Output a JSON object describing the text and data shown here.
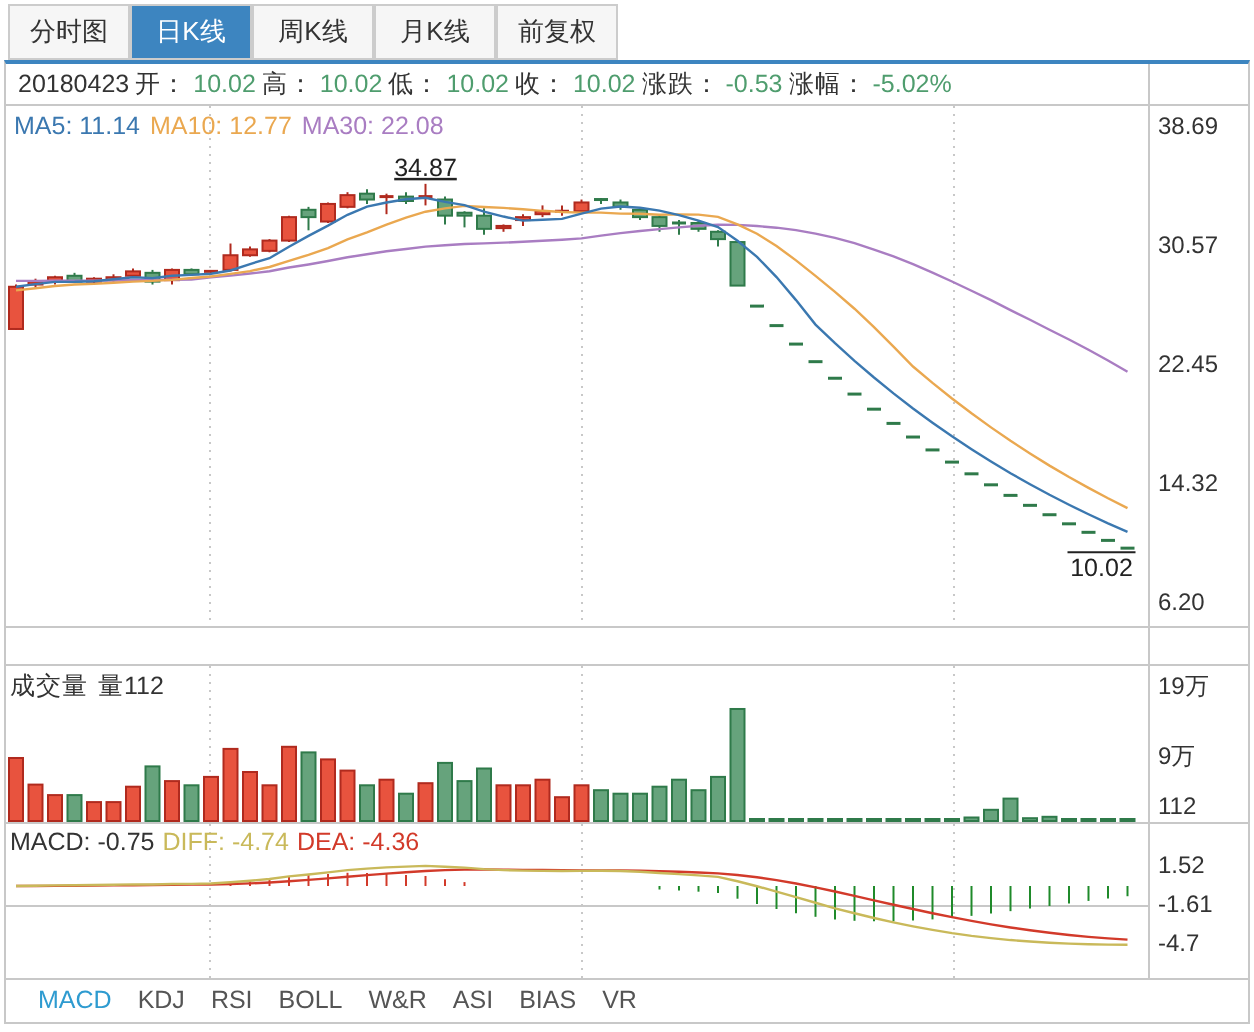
{
  "tabs": [
    {
      "label": "分时图",
      "selected": false
    },
    {
      "label": "日K线",
      "selected": true
    },
    {
      "label": "周K线",
      "selected": false
    },
    {
      "label": "月K线",
      "selected": false
    },
    {
      "label": "前复权",
      "selected": false
    }
  ],
  "quote": {
    "date": "20180423",
    "fields": [
      {
        "label": "开：",
        "value": "10.02"
      },
      {
        "label": "高：",
        "value": "10.02"
      },
      {
        "label": "低：",
        "value": "10.02"
      },
      {
        "label": "收：",
        "value": "10.02"
      },
      {
        "label": "涨跌：",
        "value": "-0.53"
      },
      {
        "label": "涨幅：",
        "value": "-5.02%"
      }
    ]
  },
  "price_chart": {
    "legend": [
      {
        "text": "MA5: 11.14",
        "color": "#3b78b0"
      },
      {
        "text": "MA10: 12.77",
        "color": "#eaa850"
      },
      {
        "text": "MA30: 22.08",
        "color": "#a97dc2"
      }
    ],
    "high_label": "34.87",
    "low_label": "10.02",
    "chart_data": {
      "type": "candlestick",
      "ylim": [
        4.71,
        40.18
      ],
      "grid": true,
      "categories": [
        null,
        null,
        null,
        null,
        null,
        null,
        null,
        null,
        null,
        null,
        null,
        null,
        null,
        null,
        null,
        null,
        null,
        null,
        null,
        null,
        null,
        null,
        null,
        null,
        null,
        null,
        null,
        null,
        null,
        null,
        null,
        null,
        null,
        null,
        null,
        null,
        null,
        null,
        null,
        null,
        null,
        null,
        null,
        null,
        null,
        null,
        null,
        null,
        null,
        null,
        null,
        null,
        null,
        null,
        null,
        null,
        null,
        null
      ],
      "ohlc": [
        [
          24.97,
          28.0,
          24.9,
          27.85
        ],
        [
          28.0,
          28.4,
          27.8,
          28.2
        ],
        [
          28.2,
          28.6,
          28.0,
          28.5
        ],
        [
          28.6,
          28.8,
          28.1,
          28.2
        ],
        [
          28.2,
          28.5,
          28.0,
          28.4
        ],
        [
          28.3,
          28.7,
          28.2,
          28.5
        ],
        [
          28.6,
          29.1,
          28.5,
          28.9
        ],
        [
          28.8,
          29.0,
          28.0,
          28.2
        ],
        [
          28.3,
          29.1,
          28.0,
          29.0
        ],
        [
          29.0,
          29.1,
          28.6,
          28.7
        ],
        [
          28.8,
          29.0,
          28.7,
          28.9
        ],
        [
          29.0,
          30.8,
          28.9,
          30.0
        ],
        [
          30.0,
          30.6,
          29.9,
          30.4
        ],
        [
          30.3,
          31.1,
          30.2,
          31.0
        ],
        [
          31.0,
          32.7,
          30.9,
          32.6
        ],
        [
          33.1,
          33.3,
          31.7,
          32.6
        ],
        [
          32.3,
          33.6,
          32.2,
          33.5
        ],
        [
          33.3,
          34.3,
          33.2,
          34.1
        ],
        [
          34.2,
          34.5,
          33.5,
          33.8
        ],
        [
          33.9,
          34.2,
          32.8,
          34.0
        ],
        [
          34.0,
          34.3,
          33.5,
          33.7
        ],
        [
          33.9,
          34.87,
          33.4,
          34.0
        ],
        [
          33.8,
          34.0,
          32.1,
          32.7
        ],
        [
          32.9,
          33.0,
          31.9,
          32.7
        ],
        [
          32.7,
          33.2,
          31.4,
          31.8
        ],
        [
          31.85,
          32.1,
          31.6,
          32.0
        ],
        [
          32.4,
          32.8,
          32.0,
          32.6
        ],
        [
          32.8,
          33.4,
          32.6,
          33.0
        ],
        [
          32.9,
          33.4,
          32.7,
          33.0
        ],
        [
          33.0,
          33.8,
          32.9,
          33.6
        ],
        [
          33.8,
          33.9,
          33.5,
          33.7
        ],
        [
          33.6,
          33.8,
          33.1,
          33.3
        ],
        [
          33.1,
          33.2,
          32.4,
          32.6
        ],
        [
          32.6,
          32.7,
          31.6,
          32.0
        ],
        [
          32.2,
          32.4,
          31.4,
          32.1
        ],
        [
          32.2,
          32.4,
          31.6,
          31.8
        ],
        [
          31.6,
          31.7,
          30.6,
          31.1
        ],
        [
          30.9,
          30.9,
          27.93,
          27.93
        ],
        [
          26.53,
          26.53,
          26.53,
          26.53
        ],
        [
          25.2,
          25.2,
          25.2,
          25.2
        ],
        [
          23.94,
          23.94,
          23.94,
          23.94
        ],
        [
          22.74,
          22.74,
          22.74,
          22.74
        ],
        [
          21.61,
          21.61,
          21.61,
          21.61
        ],
        [
          20.53,
          20.53,
          20.53,
          20.53
        ],
        [
          19.5,
          19.5,
          19.5,
          19.5
        ],
        [
          18.53,
          18.53,
          18.53,
          18.53
        ],
        [
          17.6,
          17.6,
          17.6,
          17.6
        ],
        [
          16.72,
          16.72,
          16.72,
          16.72
        ],
        [
          15.89,
          15.89,
          15.89,
          15.89
        ],
        [
          15.09,
          15.09,
          15.09,
          15.09
        ],
        [
          14.34,
          14.34,
          14.34,
          14.34
        ],
        [
          13.62,
          13.62,
          13.62,
          13.62
        ],
        [
          12.94,
          12.94,
          12.94,
          12.94
        ],
        [
          12.3,
          12.3,
          12.3,
          12.3
        ],
        [
          11.68,
          11.68,
          11.68,
          11.68
        ],
        [
          11.1,
          11.1,
          11.1,
          11.1
        ],
        [
          10.55,
          10.55,
          10.55,
          10.55
        ],
        [
          10.02,
          10.02,
          10.02,
          10.02
        ]
      ],
      "yticks": [
        {
          "value": 38.69,
          "label": "38.69"
        },
        {
          "value": 30.57,
          "label": "30.57"
        },
        {
          "value": 22.45,
          "label": "22.45"
        },
        {
          "value": 14.32,
          "label": "14.32"
        },
        {
          "value": 6.2,
          "label": "6.20"
        }
      ],
      "series": [
        {
          "type": "line",
          "color": "#3b78b0",
          "values": [
            27.85,
            28.03,
            28.18,
            28.19,
            28.23,
            28.36,
            28.5,
            28.44,
            28.6,
            28.66,
            28.74,
            28.96,
            29.4,
            29.8,
            30.58,
            31.32,
            32.02,
            32.76,
            33.32,
            33.6,
            33.82,
            33.92,
            33.64,
            33.42,
            32.98,
            32.64,
            32.36,
            32.42,
            32.48,
            32.84,
            33.18,
            33.32,
            33.24,
            33.04,
            32.74,
            32.36,
            31.92,
            30.99,
            29.89,
            28.51,
            26.94,
            25.27,
            24.0,
            22.8,
            21.66,
            20.58,
            19.55,
            18.58,
            17.65,
            16.77,
            15.93,
            15.13,
            14.38,
            13.66,
            12.98,
            12.33,
            11.71,
            11.13
          ]
        },
        {
          "type": "line",
          "color": "#eaa850",
          "values": [
            27.6,
            27.75,
            27.9,
            28.0,
            28.05,
            28.12,
            28.2,
            28.25,
            28.32,
            28.45,
            28.55,
            28.73,
            28.92,
            29.2,
            29.62,
            30.03,
            30.49,
            31.08,
            31.56,
            32.09,
            32.57,
            32.97,
            33.2,
            33.37,
            33.29,
            33.23,
            33.14,
            33.03,
            32.95,
            32.91,
            32.91,
            32.84,
            32.83,
            32.76,
            32.79,
            32.77,
            32.62,
            32.11,
            31.47,
            30.63,
            29.65,
            28.59,
            27.5,
            26.35,
            25.09,
            23.76,
            22.41,
            21.29,
            20.23,
            19.22,
            18.26,
            17.34,
            16.48,
            15.65,
            14.87,
            14.13,
            13.42,
            12.75
          ]
        },
        {
          "type": "line",
          "color": "#a97dc2",
          "values": [
            28.25,
            28.25,
            28.26,
            28.27,
            28.27,
            28.28,
            28.3,
            28.31,
            28.33,
            28.35,
            28.49,
            28.61,
            28.75,
            28.91,
            29.16,
            29.37,
            29.61,
            29.86,
            30.07,
            30.27,
            30.43,
            30.59,
            30.68,
            30.77,
            30.81,
            30.86,
            30.92,
            30.99,
            31.06,
            31.15,
            31.34,
            31.51,
            31.65,
            31.78,
            31.9,
            32.01,
            32.08,
            32.07,
            31.99,
            31.88,
            31.71,
            31.47,
            31.18,
            30.83,
            30.39,
            29.92,
            29.39,
            28.81,
            28.21,
            27.58,
            26.94,
            26.26,
            25.6,
            24.92,
            24.25,
            23.55,
            22.82,
            22.05
          ]
        }
      ]
    }
  },
  "volume_chart": {
    "title": "成交量",
    "reading": "量112",
    "axis_reading": "112",
    "chart_data": {
      "type": "bar",
      "ylim": [
        0,
        22.14
      ],
      "grid": true,
      "yticks": [
        {
          "value": 19,
          "label": "19万"
        },
        {
          "value": 9,
          "label": "9万"
        }
      ],
      "categories": [
        null,
        null,
        null,
        null,
        null,
        null,
        null,
        null,
        null,
        null,
        null,
        null,
        null,
        null,
        null,
        null,
        null,
        null,
        null,
        null,
        null,
        null,
        null,
        null,
        null,
        null,
        null,
        null,
        null,
        null,
        null,
        null,
        null,
        null,
        null,
        null,
        null,
        null,
        null,
        null,
        null,
        null,
        null,
        null,
        null,
        null,
        null,
        null,
        null,
        null,
        null,
        null,
        null,
        null,
        null,
        null,
        null,
        null
      ],
      "series": [
        {
          "values": [
            9.0,
            5.2,
            3.7,
            3.7,
            2.7,
            2.7,
            4.9,
            7.8,
            5.7,
            5.1,
            6.3,
            10.3,
            7.0,
            5.1,
            10.6,
            9.8,
            8.8,
            7.2,
            5.1,
            5.9,
            3.9,
            5.4,
            8.3,
            5.7,
            7.5,
            5.1,
            5.1,
            5.9,
            3.4,
            5.1,
            4.4,
            3.9,
            3.9,
            4.9,
            5.9,
            4.4,
            6.3,
            16.0,
            0.05,
            0.05,
            0.05,
            0.05,
            0.05,
            0.05,
            0.05,
            0.05,
            0.05,
            0.05,
            0.2,
            0.5,
            1.6,
            3.2,
            0.4,
            0.6,
            0.05,
            0.05,
            0.05,
            0.0112
          ]
        }
      ]
    }
  },
  "macd_chart": {
    "legend": [
      {
        "text": "MACD: -0.75",
        "color": "#333333"
      },
      {
        "text": "DIFF: -4.74",
        "color": "#c9b95a"
      },
      {
        "text": "DEA: -4.36",
        "color": "#d23a2a"
      }
    ],
    "chart_data": {
      "type": "line",
      "ylim": [
        -7.58,
        5
      ],
      "grid": true,
      "ref_lines": [
        {
          "value": -1.61,
          "axis": "y"
        }
      ],
      "yticks": [
        {
          "value": 1.52,
          "label": "1.52"
        },
        {
          "value": -1.61,
          "label": "-1.61"
        },
        {
          "value": -4.7,
          "label": "-4.7"
        }
      ],
      "categories": [
        null,
        null,
        null,
        null,
        null,
        null,
        null,
        null,
        null,
        null,
        null,
        null,
        null,
        null,
        null,
        null,
        null,
        null,
        null,
        null,
        null,
        null,
        null,
        null,
        null,
        null,
        null,
        null,
        null,
        null,
        null,
        null,
        null,
        null,
        null,
        null,
        null,
        null,
        null,
        null,
        null,
        null,
        null,
        null,
        null,
        null,
        null,
        null,
        null,
        null,
        null,
        null,
        null,
        null,
        null,
        null,
        null,
        null
      ],
      "series": [
        {
          "color": "#c9b95a",
          "values": [
            0,
            0.02,
            0.05,
            0.06,
            0.08,
            0.1,
            0.13,
            0.12,
            0.16,
            0.17,
            0.2,
            0.3,
            0.42,
            0.57,
            0.78,
            0.93,
            1.1,
            1.28,
            1.4,
            1.5,
            1.56,
            1.62,
            1.55,
            1.48,
            1.36,
            1.28,
            1.24,
            1.22,
            1.21,
            1.22,
            1.23,
            1.21,
            1.15,
            1.05,
            0.96,
            0.86,
            0.74,
            0.38,
            -0.02,
            -0.45,
            -0.9,
            -1.35,
            -1.8,
            -2.2,
            -2.58,
            -2.93,
            -3.25,
            -3.54,
            -3.8,
            -4.02,
            -4.2,
            -4.36,
            -4.48,
            -4.58,
            -4.65,
            -4.7,
            -4.73,
            -4.74
          ]
        },
        {
          "color": "#d23a2a",
          "values": [
            0,
            0.004,
            0.013,
            0.022,
            0.034,
            0.047,
            0.064,
            0.075,
            0.092,
            0.108,
            0.126,
            0.161,
            0.213,
            0.284,
            0.383,
            0.492,
            0.614,
            0.747,
            0.878,
            1.002,
            1.114,
            1.215,
            1.282,
            1.322,
            1.33,
            1.32,
            1.304,
            1.287,
            1.272,
            1.262,
            1.256,
            1.247,
            1.228,
            1.192,
            1.146,
            1.089,
            1.02,
            0.892,
            0.71,
            0.478,
            0.202,
            -0.108,
            -0.446,
            -0.797,
            -1.154,
            -1.509,
            -1.857,
            -2.194,
            -2.515,
            -2.816,
            -3.093,
            -3.346,
            -3.573,
            -3.774,
            -3.949,
            -4.099,
            -4.225,
            -4.328
          ]
        }
      ]
    }
  },
  "indicator_tabs": [
    {
      "label": "MACD",
      "selected": true
    },
    {
      "label": "KDJ",
      "selected": false
    },
    {
      "label": "RSI",
      "selected": false
    },
    {
      "label": "BOLL",
      "selected": false
    },
    {
      "label": "W&R",
      "selected": false
    },
    {
      "label": "ASI",
      "selected": false
    },
    {
      "label": "BIAS",
      "selected": false
    },
    {
      "label": "VR",
      "selected": false
    }
  ]
}
